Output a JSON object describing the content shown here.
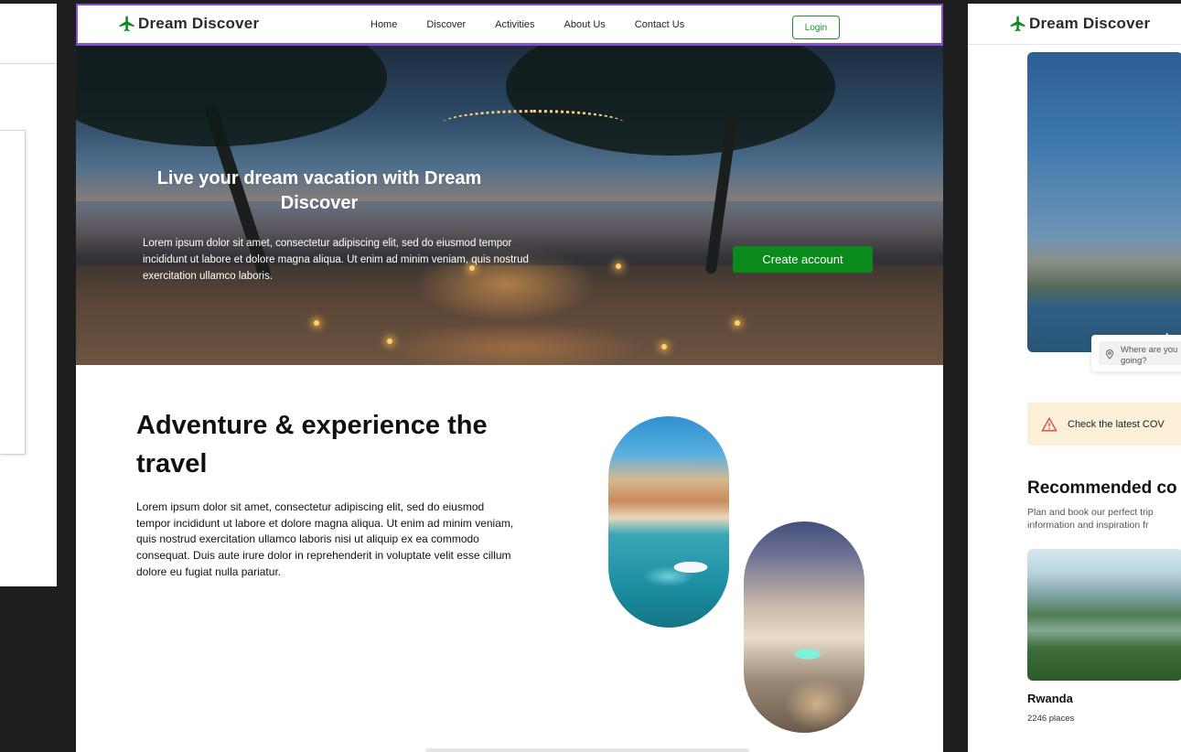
{
  "main": {
    "brand": "Dream Discover",
    "nav": [
      "Home",
      "Discover",
      "Activities",
      "About Us",
      "Contact Us"
    ],
    "login_label": "Login",
    "hero": {
      "title": "Live your dream vacation with Dream Discover",
      "text": "Lorem ipsum dolor sit amet, consectetur adipiscing elit, sed do eiusmod tempor incididunt ut labore et dolore magna aliqua. Ut enim ad minim veniam, quis nostrud exercitation ullamco laboris.",
      "cta": "Create account"
    },
    "adventure": {
      "title": "Adventure & experience the travel",
      "text": "Lorem ipsum dolor sit amet, consectetur adipiscing elit, sed do eiusmod tempor incididunt ut labore et dolore magna aliqua. Ut enim ad minim veniam, quis nostrud exercitation ullamco laboris nisi ut aliquip ex ea commodo consequat. Duis aute irure dolor in reprehenderit in voluptate velit esse cillum dolore eu fugiat nulla pariatur."
    }
  },
  "right": {
    "brand": "Dream Discover",
    "search_placeholder": "Where are you going?",
    "alert": "Check the latest COV",
    "recommended_title": "Recommended co",
    "recommended_sub_1": "Plan and book our perfect trip",
    "recommended_sub_2": "information and  inspiration fr",
    "card": {
      "name": "Rwanda",
      "count": "2246 places"
    }
  },
  "colors": {
    "brand_green": "#0a8a1a",
    "selection": "#8a4bd6",
    "alert_bg": "#fbefd8"
  },
  "icons": {
    "brand": "airplane-icon",
    "search": "location-pin-icon",
    "alert": "warning-triangle-icon"
  }
}
